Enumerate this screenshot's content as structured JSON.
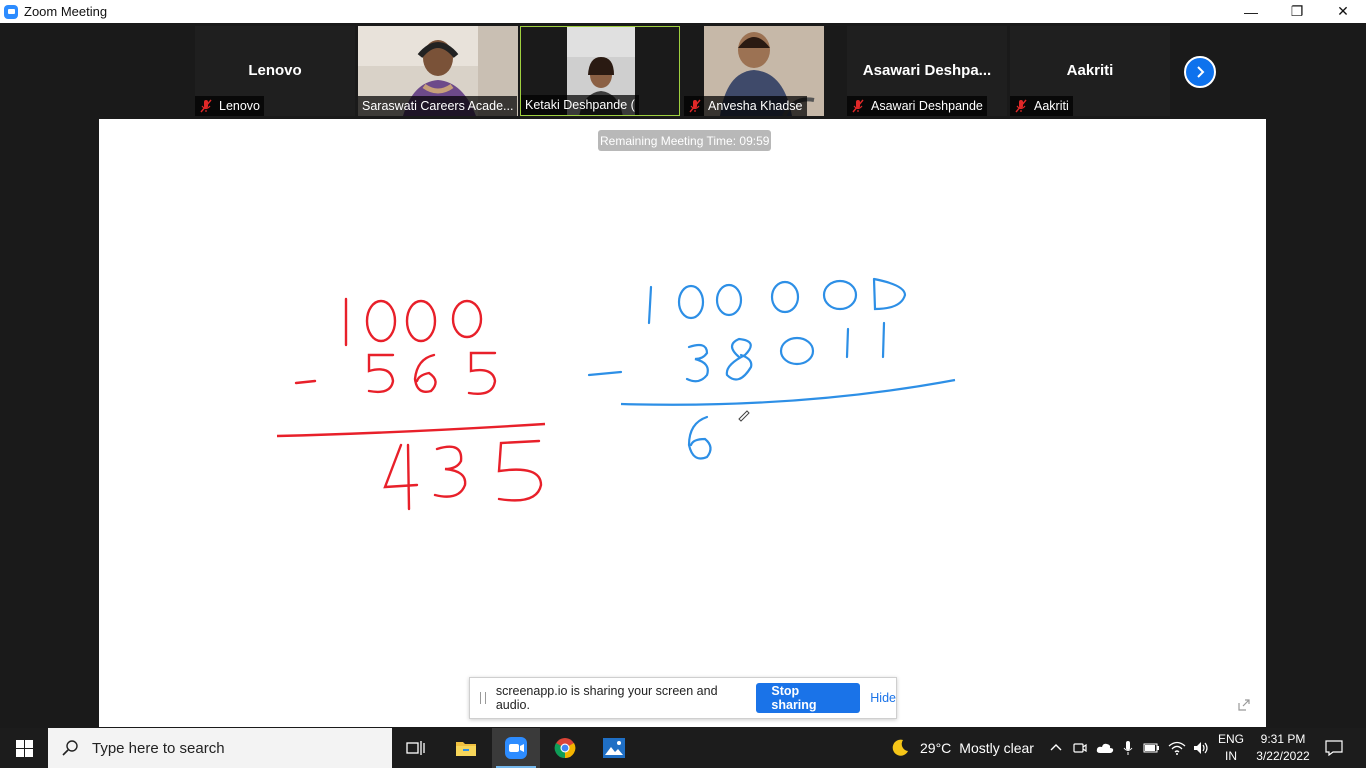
{
  "window": {
    "title": "Zoom Meeting",
    "minimize": "—",
    "restore": "❐",
    "close": "✕"
  },
  "gallery": {
    "tiles": [
      {
        "big_name": "Lenovo",
        "label": "Lenovo",
        "muted": true,
        "video": false
      },
      {
        "big_name": "",
        "label": "Saraswati Careers Acade...",
        "muted": false,
        "video": true
      },
      {
        "big_name": "",
        "label": "Ketaki Deshpande (",
        "muted": false,
        "video": true,
        "active_speaker": true
      },
      {
        "big_name": "",
        "label": "Anvesha Khadse",
        "muted": true,
        "video": true
      },
      {
        "big_name": "Asawari  Deshpa...",
        "label": "Asawari Deshpande",
        "muted": true,
        "video": false
      },
      {
        "big_name": "Aakriti",
        "label": "Aakriti",
        "muted": true,
        "video": false
      }
    ],
    "next_icon": "chevron-right-icon"
  },
  "meeting": {
    "remaining_time": "Remaining Meeting Time: 09:59"
  },
  "whiteboard": {
    "red_problem": {
      "top": "1000",
      "subtract": "565",
      "operator": "-",
      "result": "435"
    },
    "blue_problem": {
      "top": "100000",
      "subtract": "38011",
      "operator": "-",
      "partial_result": "6"
    },
    "colors": {
      "red": "#e8202a",
      "blue": "#2d8fe6"
    }
  },
  "share_bar": {
    "message": "screenapp.io is sharing your screen and audio.",
    "stop_label": "Stop sharing",
    "hide_label": "Hide"
  },
  "taskbar": {
    "search_placeholder": "Type here to search",
    "apps": [
      "task-view-icon",
      "file-explorer-icon",
      "zoom-icon",
      "chrome-icon",
      "photos-icon"
    ],
    "weather": {
      "temp": "29°C",
      "condition": "Mostly clear"
    },
    "lang": {
      "line1": "ENG",
      "line2": "IN"
    },
    "clock": {
      "time": "9:31 PM",
      "date": "3/22/2022"
    }
  }
}
